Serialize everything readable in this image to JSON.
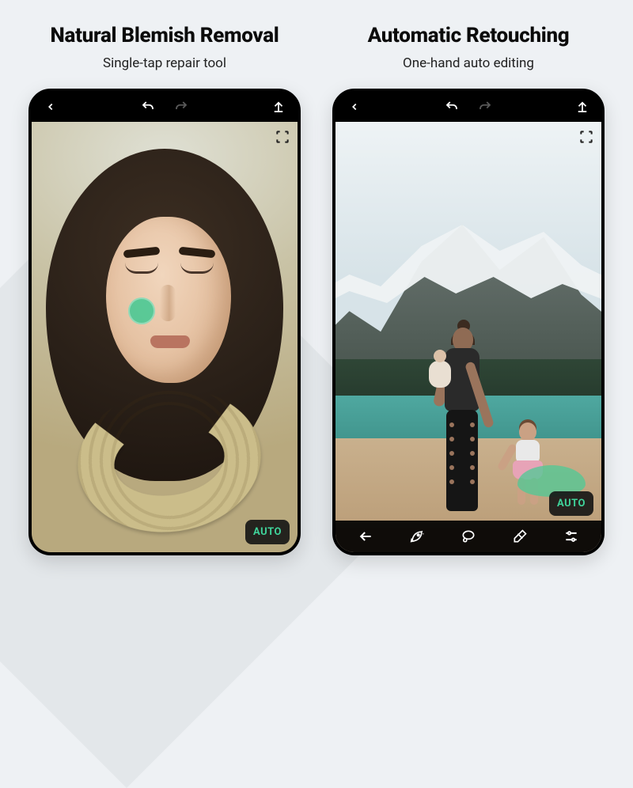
{
  "left": {
    "title": "Natural Blemish Removal",
    "subtitle": "Single-tap repair tool",
    "auto_label": "AUTO",
    "icons": {
      "back": "back-icon",
      "undo": "undo-icon",
      "redo": "redo-icon",
      "export": "export-icon",
      "focus": "focus-frame-icon",
      "heal_marker": "heal-spot-marker"
    }
  },
  "right": {
    "title": "Automatic Retouching",
    "subtitle": "One-hand auto editing",
    "auto_label": "AUTO",
    "icons": {
      "back": "back-icon",
      "undo": "undo-icon",
      "redo": "redo-icon",
      "export": "export-icon",
      "focus": "focus-frame-icon",
      "retouch_marker": "auto-retouch-marker"
    },
    "bottom_tools": [
      "back-arrow-icon",
      "magic-rocket-icon",
      "lasso-icon",
      "eraser-icon",
      "sliders-icon"
    ]
  },
  "colors": {
    "accent": "#3fd39a",
    "healing": "#4ec995",
    "phone_frame": "#000000",
    "background": "#eef1f4"
  }
}
